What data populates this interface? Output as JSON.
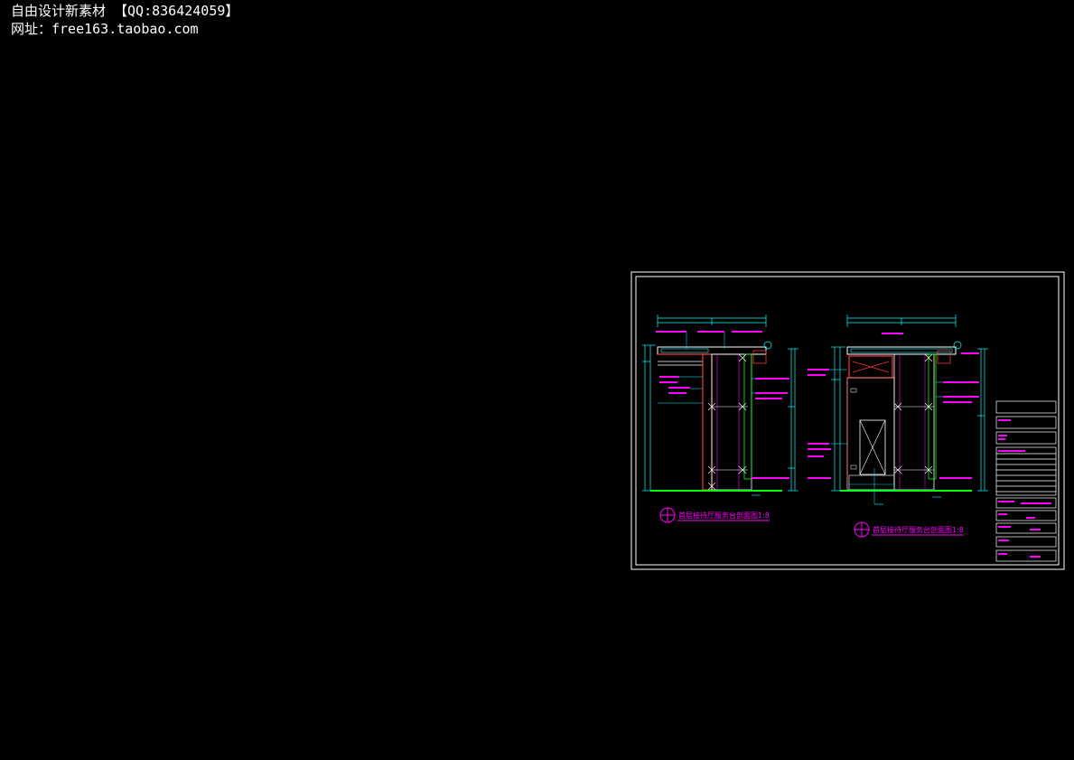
{
  "watermark": {
    "line1": "自由设计新素材   【QQ:836424059】",
    "line2": "网址：free163.taobao.com"
  },
  "colors": {
    "background": "#000000",
    "frame": "#ffffff",
    "dimension": "#00ffff",
    "annotation": "#ff00ff",
    "section": "#ff3333",
    "ground": "#00ff00",
    "outline": "#ffffff"
  },
  "drawing": {
    "sections": [
      {
        "title": "首层接待厅服务台剖面图1:8"
      },
      {
        "title": "首层接待厅服务台剖面图1:8"
      }
    ]
  }
}
